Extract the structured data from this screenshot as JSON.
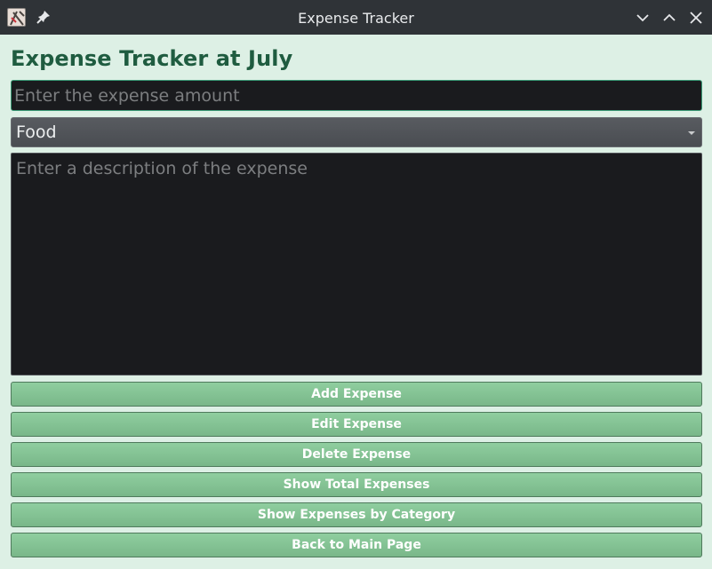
{
  "window": {
    "title": "Expense Tracker"
  },
  "header": {
    "heading": "Expense Tracker at July"
  },
  "form": {
    "amount_placeholder": "Enter the expense amount",
    "amount_value": "",
    "category_selected": "Food",
    "description_placeholder": "Enter a description of the expense",
    "description_value": ""
  },
  "buttons": {
    "add": "Add Expense",
    "edit": "Edit Expense",
    "delete": "Delete Expense",
    "show_total": "Show Total Expenses",
    "show_by_category": "Show Expenses by Category",
    "back": "Back to Main Page"
  },
  "colors": {
    "background": "#ddf0e5",
    "heading": "#1f5c40",
    "button": "#85c495",
    "titlebar": "#2f3337"
  },
  "icons": {
    "app": "app-logo-icon",
    "pin": "pin-icon",
    "minimize": "chevron-down-icon",
    "maximize": "chevron-up-icon",
    "close": "close-icon",
    "dropdown": "dropdown-arrow-icon"
  }
}
